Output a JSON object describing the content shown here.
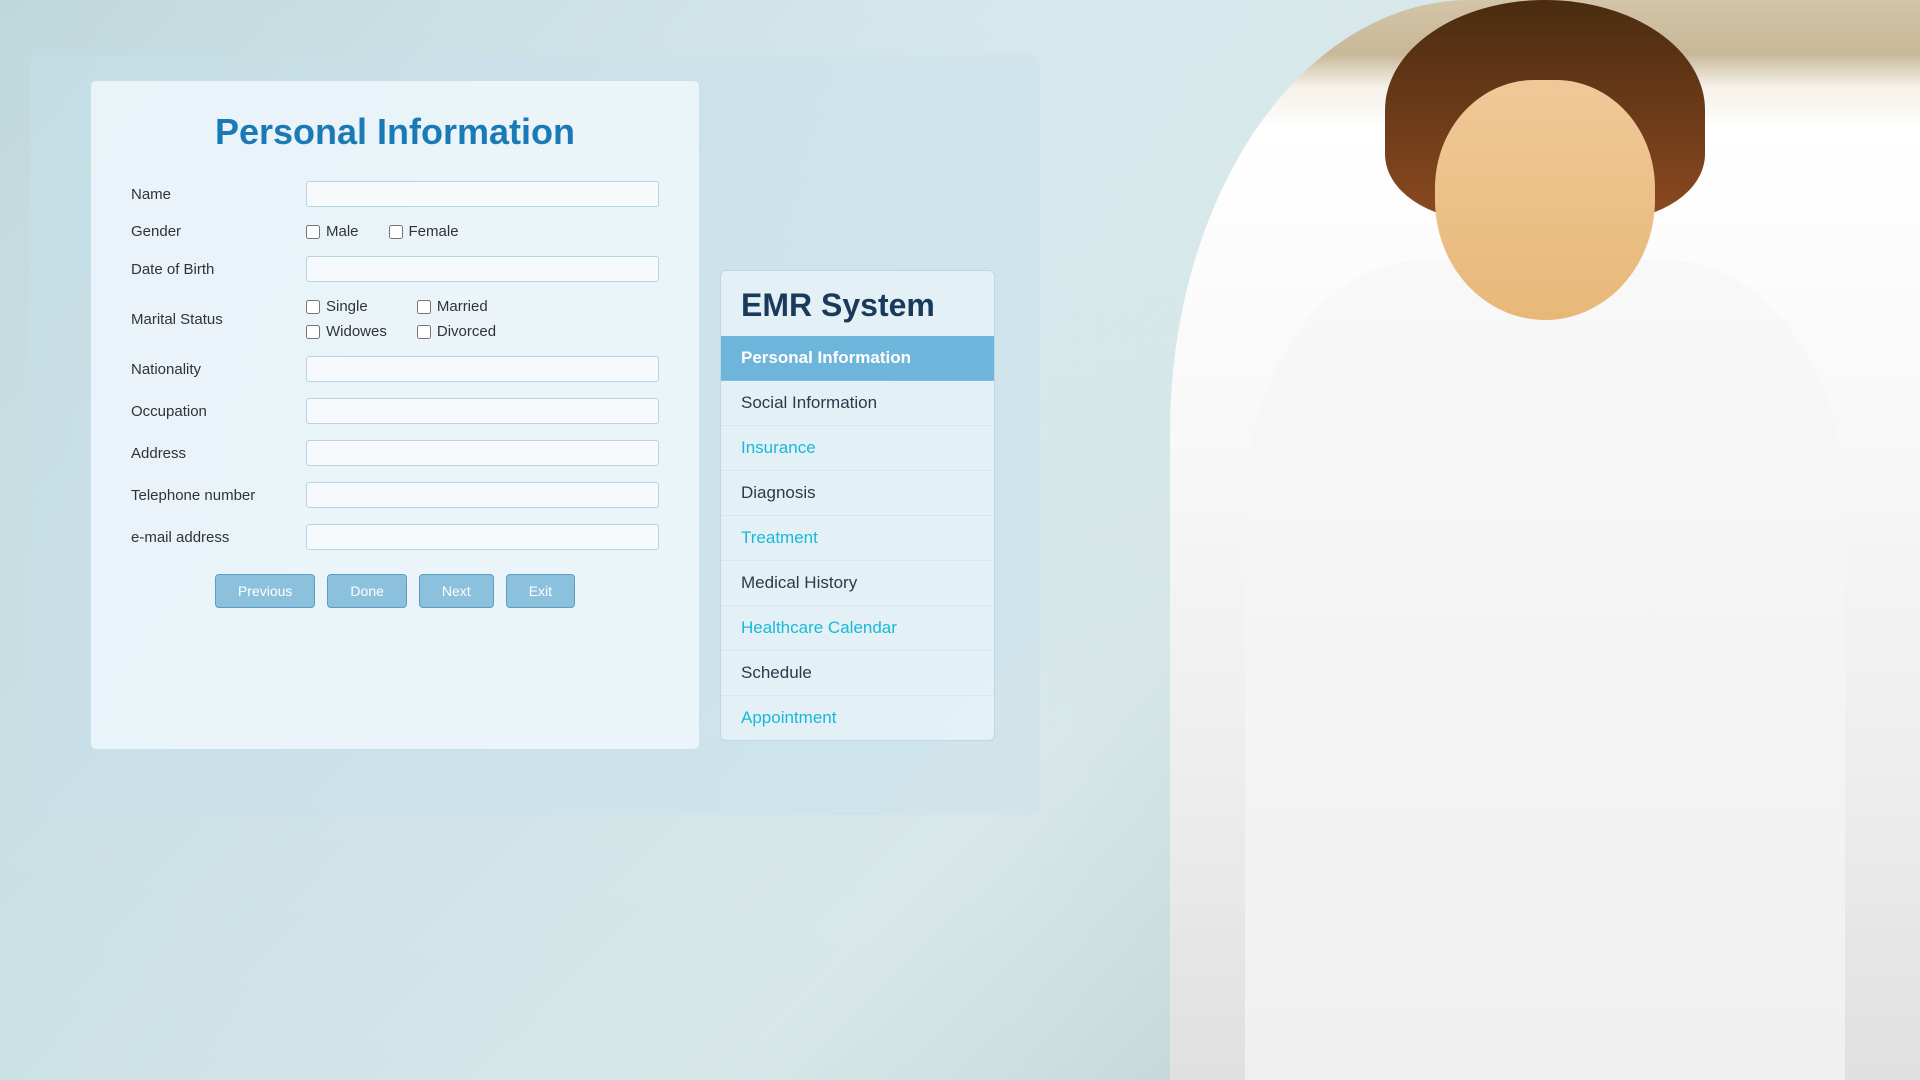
{
  "background": {
    "color": "#b8d4d8"
  },
  "form": {
    "title": "Personal Information",
    "fields": {
      "name_label": "Name",
      "gender_label": "Gender",
      "dob_label": "Date of Birth",
      "marital_label": "Marital Status",
      "nationality_label": "Nationality",
      "occupation_label": "Occupation",
      "address_label": "Address",
      "telephone_label": "Telephone number",
      "email_label": "e-mail address"
    },
    "gender_options": [
      "Male",
      "Female"
    ],
    "marital_options": [
      "Single",
      "Married",
      "Widowes",
      "Divorced"
    ],
    "buttons": {
      "previous": "Previous",
      "done": "Done",
      "next": "Next",
      "exit": "Exit"
    }
  },
  "emr": {
    "title": "EMR System",
    "menu_items": [
      {
        "label": "Personal Information",
        "style": "active"
      },
      {
        "label": "Social Information",
        "style": "dark"
      },
      {
        "label": "Insurance",
        "style": "cyan"
      },
      {
        "label": "Diagnosis",
        "style": "dark"
      },
      {
        "label": "Treatment",
        "style": "cyan"
      },
      {
        "label": "Medical History",
        "style": "dark"
      },
      {
        "label": "Healthcare Calendar",
        "style": "cyan"
      },
      {
        "label": "Schedule",
        "style": "dark"
      },
      {
        "label": "Appointment",
        "style": "cyan"
      }
    ]
  }
}
